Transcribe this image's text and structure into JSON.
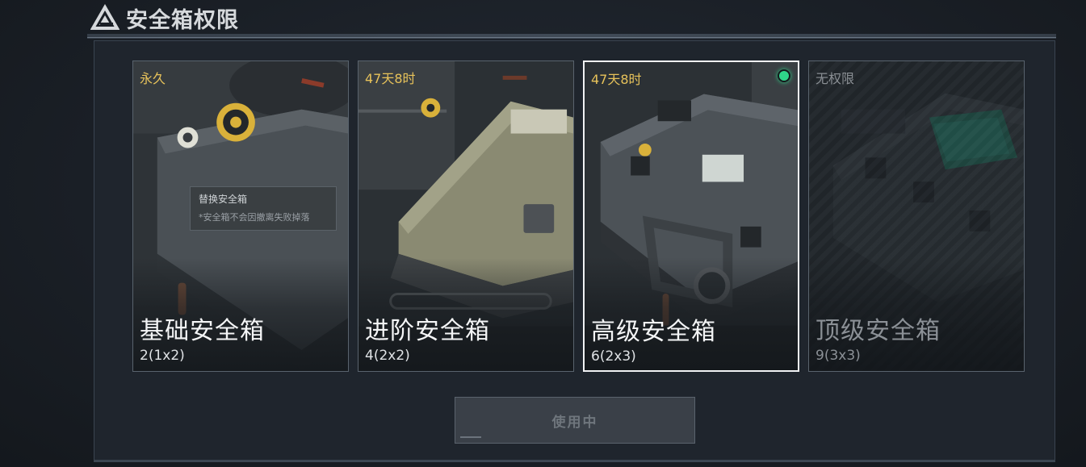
{
  "header": {
    "title": "安全箱权限"
  },
  "tooltip": {
    "title": "替换安全箱",
    "note": "*安全箱不会因撤离失败掉落"
  },
  "cards": [
    {
      "tag": "永久",
      "name": "基础安全箱",
      "size": "2(1x2)",
      "status": "owned"
    },
    {
      "tag": "47天8时",
      "name": "进阶安全箱",
      "size": "4(2x2)",
      "status": "owned"
    },
    {
      "tag": "47天8时",
      "name": "高级安全箱",
      "size": "6(2x3)",
      "status": "selected"
    },
    {
      "tag": "无权限",
      "name": "顶级安全箱",
      "size": "9(3x3)",
      "status": "locked"
    }
  ],
  "use_button": {
    "label": "使用中",
    "enabled": false
  },
  "colors": {
    "timer": "#e7c25a",
    "active_dot": "#2fd58a",
    "locked_text": "#8b9096"
  },
  "icons": {
    "logo": "triangle-logo-icon",
    "active": "active-dot-icon"
  }
}
